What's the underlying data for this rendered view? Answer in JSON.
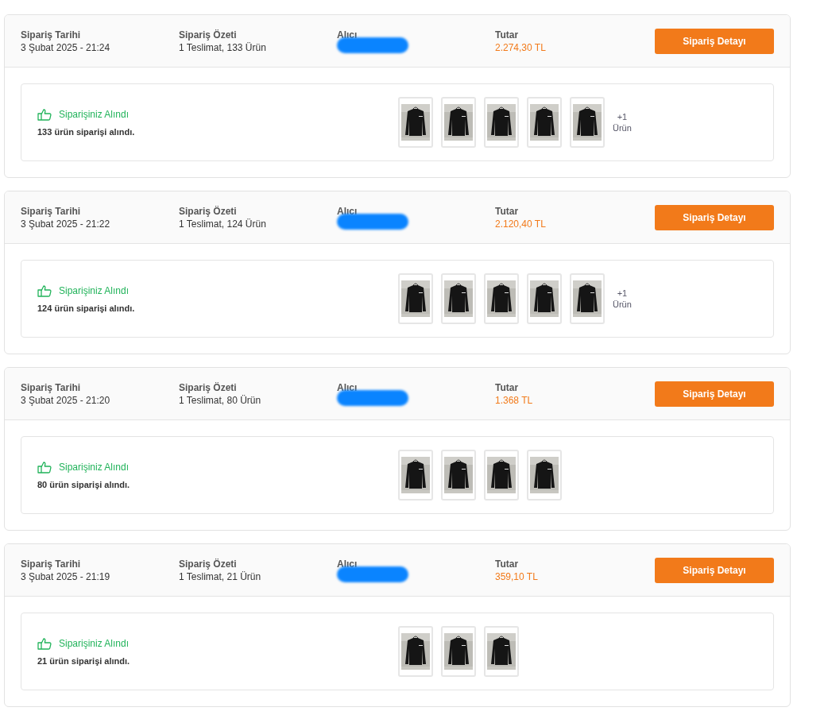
{
  "orders": [
    {
      "date_label": "Sipariş Tarihi",
      "date": "3 Şubat 2025 - 21:24",
      "summary_label": "Sipariş Özeti",
      "summary": "1 Teslimat, 133 Ürün",
      "recipient_label": "Alıcı",
      "recipient_redacted": true,
      "total_label": "Tutar",
      "total": "2.274,30 TL",
      "button": "Sipariş Detayı",
      "status": "Siparişiniz Alındı",
      "message": "133 ürün siparişi alındı.",
      "products": [
        {
          "kind": "picture"
        },
        {
          "kind": "picture"
        },
        {
          "kind": "picture"
        },
        {
          "kind": "picture"
        },
        {
          "kind": "picture"
        }
      ],
      "more": [
        "+1",
        "Ürün"
      ]
    },
    {
      "date_label": "Sipariş Tarihi",
      "date": "3 Şubat 2025 - 21:22",
      "summary_label": "Sipariş Özeti",
      "summary": "1 Teslimat, 124 Ürün",
      "recipient_label": "Alıcı",
      "recipient_redacted": true,
      "total_label": "Tutar",
      "total": "2.120,40 TL",
      "button": "Sipariş Detayı",
      "status": "Siparişiniz Alındı",
      "message": "124 ürün siparişi alındı.",
      "products": [
        {
          "kind": "picture"
        },
        {
          "kind": "picture"
        },
        {
          "kind": "picture"
        },
        {
          "kind": "picture"
        },
        {
          "kind": "picture"
        }
      ],
      "more": [
        "+1",
        "Ürün"
      ]
    },
    {
      "date_label": "Sipariş Tarihi",
      "date": "3 Şubat 2025 - 21:20",
      "summary_label": "Sipariş Özeti",
      "summary": "1 Teslimat, 80 Ürün",
      "recipient_label": "Alıcı",
      "recipient_redacted": true,
      "total_label": "Tutar",
      "total": "1.368 TL",
      "button": "Sipariş Detayı",
      "status": "Siparişiniz Alındı",
      "message": "80 ürün siparişi alındı.",
      "products": [
        {
          "kind": "picture"
        },
        {
          "kind": "picture"
        },
        {
          "kind": "picture"
        },
        {
          "kind": "picture"
        }
      ]
    },
    {
      "date_label": "Sipariş Tarihi",
      "date": "3 Şubat 2025 - 21:19",
      "summary_label": "Sipariş Özeti",
      "summary": "1 Teslimat, 21 Ürün",
      "recipient_label": "Alıcı",
      "recipient_redacted": true,
      "total_label": "Tutar",
      "total": "359,10 TL",
      "button": "Sipariş Detayı",
      "status": "Siparişiniz Alındı",
      "message": "21 ürün siparişi alındı.",
      "products": [
        {
          "kind": "picture"
        },
        {
          "kind": "picture"
        },
        {
          "kind": "picture"
        }
      ]
    }
  ]
}
